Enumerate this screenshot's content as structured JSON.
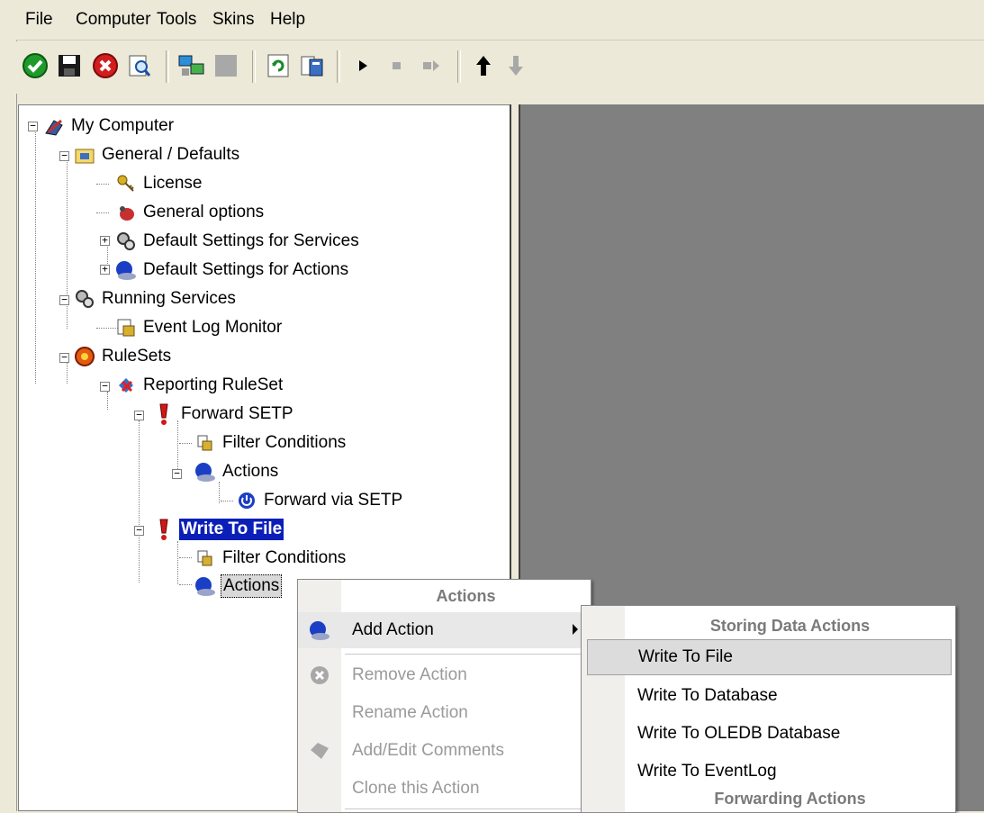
{
  "menubar": {
    "items": [
      "File",
      "Computer",
      "Tools",
      "Skins",
      "Help"
    ]
  },
  "toolbar": {
    "icons": [
      "ok-icon",
      "save-icon",
      "cancel-icon",
      "search-icon",
      "network-icon",
      "gray-square-icon",
      "refresh-icon",
      "config-icon",
      "play-icon",
      "stop-icon",
      "step-icon",
      "arrow-up-icon",
      "arrow-down-icon"
    ]
  },
  "tree": {
    "my_computer": "My Computer",
    "general_defaults": "General / Defaults",
    "license": "License",
    "general_options": "General options",
    "default_services": "Default Settings for Services",
    "default_actions": "Default Settings for Actions",
    "running_services": "Running Services",
    "event_log_monitor": "Event Log Monitor",
    "rulesets": "RuleSets",
    "reporting_ruleset": "Reporting RuleSet",
    "forward_setp": "Forward SETP",
    "filter_conditions_1": "Filter Conditions",
    "actions_1": "Actions",
    "forward_via_setp": "Forward via SETP",
    "write_to_file": "Write To File",
    "filter_conditions_2": "Filter Conditions",
    "actions_2": "Actions"
  },
  "context_menu": {
    "header": "Actions",
    "add_action": "Add Action",
    "remove_action": "Remove Action",
    "rename_action": "Rename Action",
    "add_edit_comments": "Add/Edit Comments",
    "clone_action": "Clone this Action"
  },
  "submenu": {
    "header_storing": "Storing Data Actions",
    "write_to_file": "Write To File",
    "write_to_database": "Write To Database",
    "write_to_oledb": "Write To OLEDB Database",
    "write_to_eventlog": "Write To EventLog",
    "header_forwarding": "Forwarding Actions"
  },
  "colors": {
    "selection": "#0a1fb8",
    "pane_gray": "#808080",
    "chrome": "#ece9d8"
  }
}
